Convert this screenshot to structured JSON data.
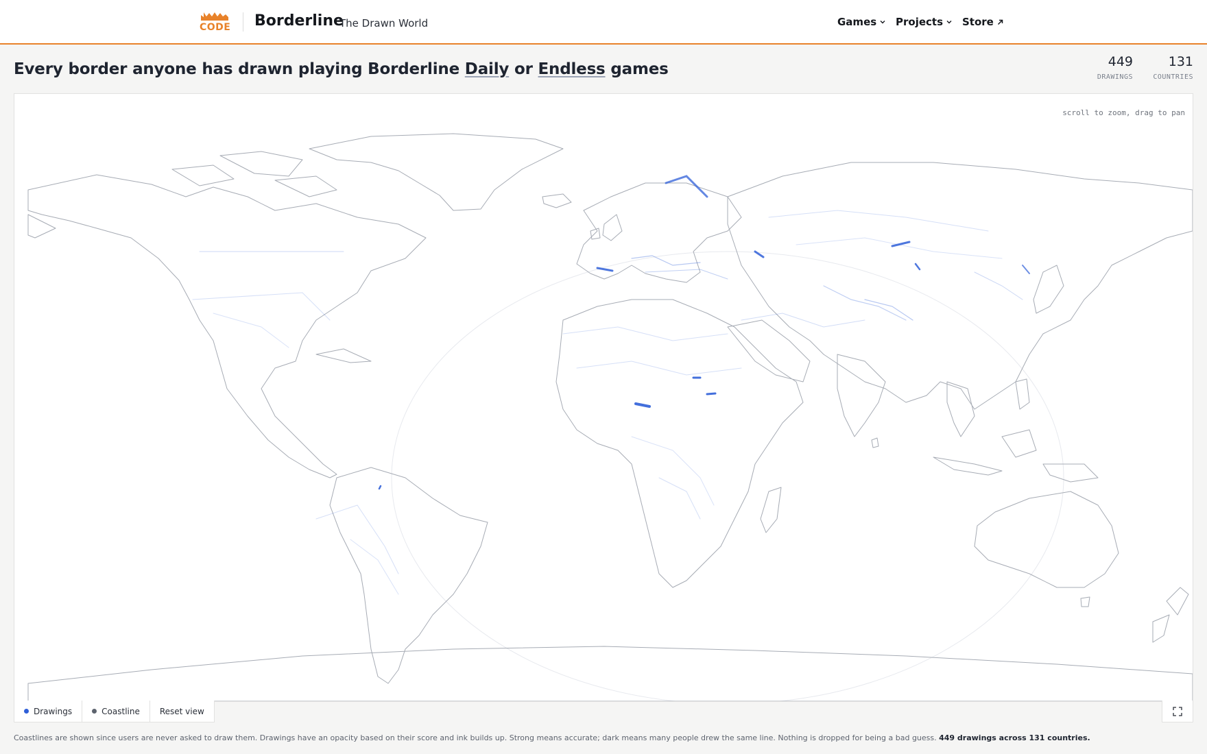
{
  "header": {
    "logo_text": "CODE",
    "brand_title": "Borderline",
    "brand_subtitle": "The Drawn World",
    "nav": [
      {
        "label": "Games",
        "icon": "chevron-down-icon"
      },
      {
        "label": "Projects",
        "icon": "chevron-down-icon"
      },
      {
        "label": "Store",
        "icon": "external-arrow-icon"
      }
    ]
  },
  "title": {
    "prefix": "Every border anyone has drawn playing Borderline ",
    "daily_link": "Daily",
    "middle": " or ",
    "endless_link": "Endless",
    "suffix": " games"
  },
  "stats": {
    "drawings_value": "449",
    "drawings_label": "DRAWINGS",
    "countries_value": "131",
    "countries_label": "COUNTRIES"
  },
  "map": {
    "hint": "scroll to zoom, drag to pan",
    "colors": {
      "drawing": "#2f5fd8",
      "coastline": "#a6abb4",
      "background": "#ffffff"
    }
  },
  "controls": {
    "drawings_label": "Drawings",
    "coastline_label": "Coastline",
    "reset_label": "Reset view",
    "drawings_color": "#2f5fd8",
    "coastline_color": "#5d636e",
    "fullscreen_icon": "expand-icon"
  },
  "footnote": {
    "text": "Coastlines are shown since users are never asked to draw them. Drawings have an opacity based on their score and ink builds up. Strong means accurate; dark means many people drew the same line. Nothing is dropped for being a bad guess. ",
    "summary": "449 drawings across 131 countries."
  }
}
